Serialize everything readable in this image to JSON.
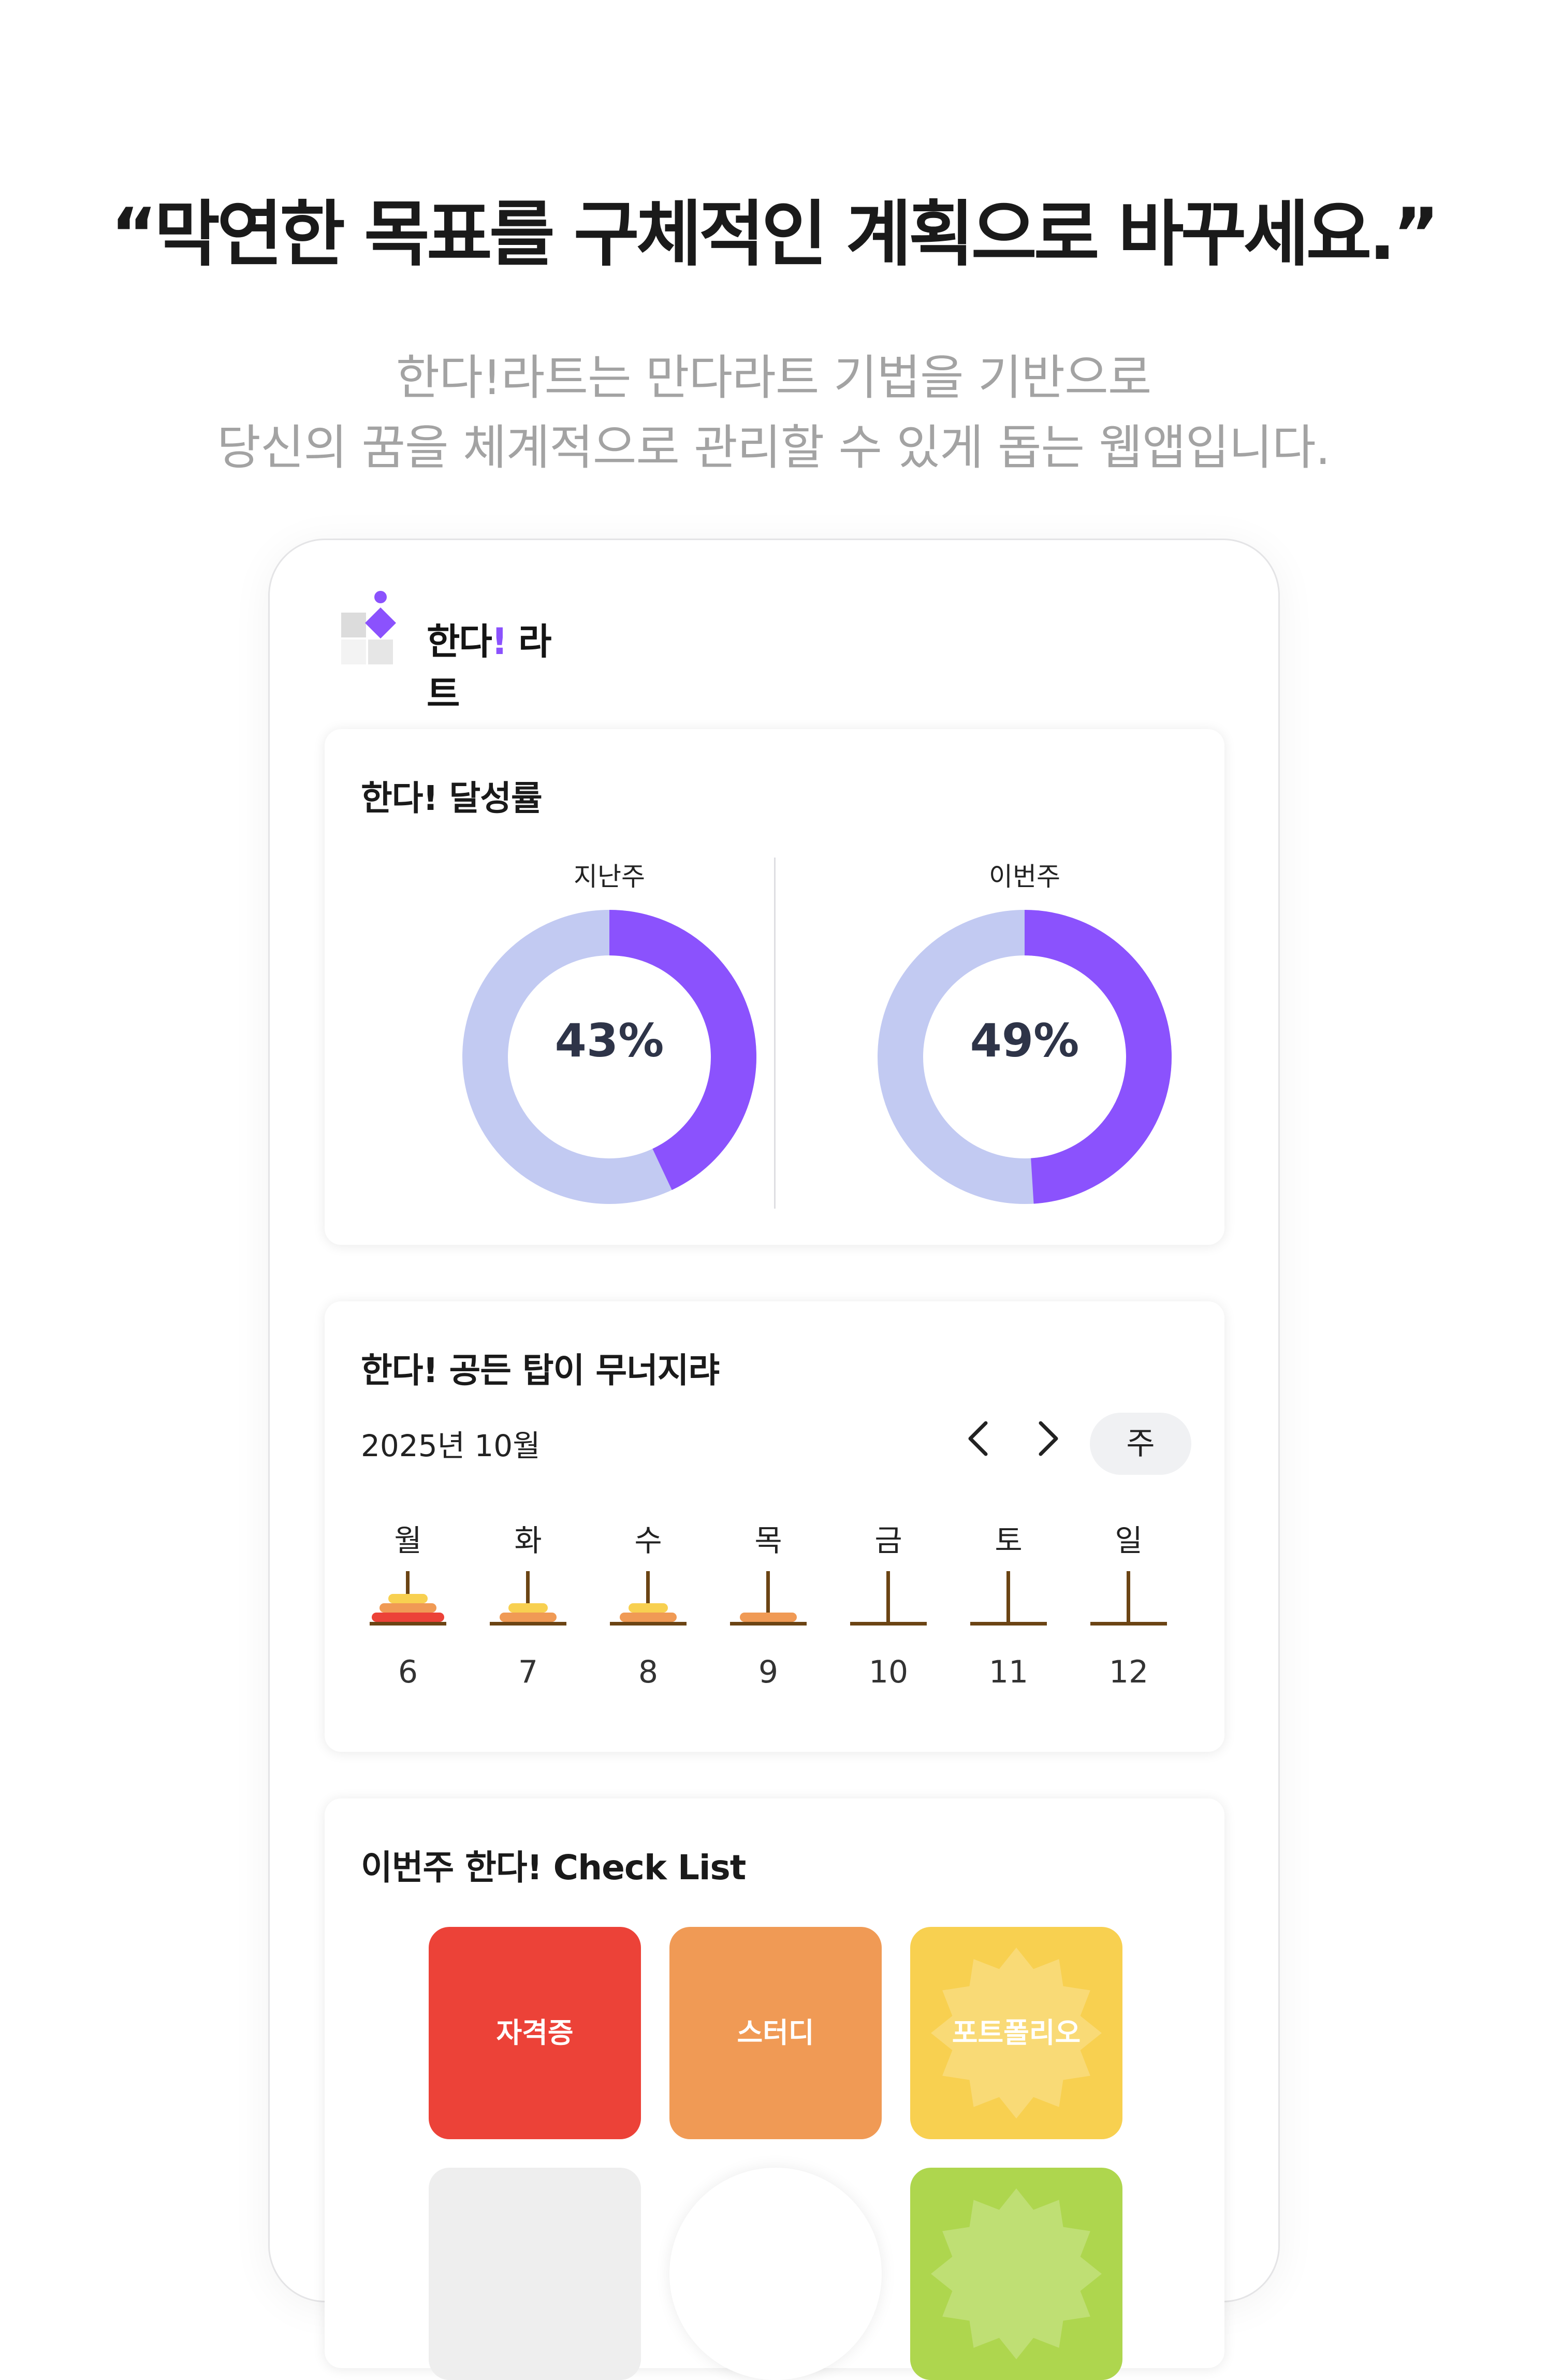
{
  "promo": {
    "headline": "“막연한 목표를 구체적인 계획으로 바꾸세요.”",
    "subline_1": "한다!라트는 만다라트 기법을 기반으로",
    "subline_2": "당신의 꿈을 체계적으로 관리할 수 있게 돕는 웹앱입니다."
  },
  "app": {
    "logo_text_main": "한다",
    "logo_text_ex": "!",
    "logo_text_tail": " 라트",
    "accent_color": "#8b52fd",
    "track_color": "#c2caf2"
  },
  "achievement": {
    "title": "한다! 달성률",
    "last_week": {
      "label": "지난주",
      "value_text": "43%",
      "percent": 43
    },
    "this_week": {
      "label": "이번주",
      "value_text": "49%",
      "percent": 49
    }
  },
  "tower": {
    "title": "한다! 공든 탑이 무너지랴",
    "month_label": "2025년 10월",
    "prev_icon": "chevron-left-icon",
    "next_icon": "chevron-right-icon",
    "view_label": "주",
    "days": [
      {
        "name": "월",
        "date": "6",
        "rings": 3
      },
      {
        "name": "화",
        "date": "7",
        "rings": 2
      },
      {
        "name": "수",
        "date": "8",
        "rings": 2
      },
      {
        "name": "목",
        "date": "9",
        "rings": 1
      },
      {
        "name": "금",
        "date": "10",
        "rings": 0
      },
      {
        "name": "토",
        "date": "11",
        "rings": 0
      },
      {
        "name": "일",
        "date": "12",
        "rings": 0
      }
    ]
  },
  "checklist": {
    "title": "이번주 한다! Check List",
    "items": [
      {
        "label": "자격증",
        "color": "#ec4238",
        "badge": false
      },
      {
        "label": "스터디",
        "color": "#f09a55",
        "badge": false
      },
      {
        "label": "포트폴리오",
        "color": "#f8d050",
        "badge": true
      },
      {
        "label": "",
        "color": "#eeeeee",
        "badge": false
      },
      {
        "label": "",
        "color": "#ffffff",
        "badge": false
      },
      {
        "label": "",
        "color": "#aed64e",
        "badge": true
      }
    ]
  }
}
